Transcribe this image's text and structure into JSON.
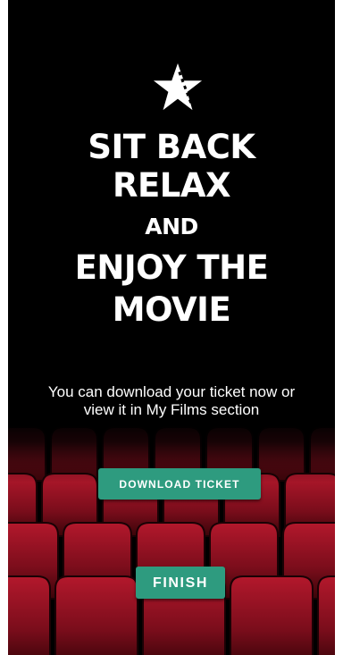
{
  "theme": {
    "background": "#000000",
    "seat_color": "#8a1020",
    "button_color": "#2e9b7f",
    "text_color": "#ffffff"
  },
  "logo": {
    "icon": "film-star-icon"
  },
  "headline": {
    "line1": "SIT BACK",
    "line2": "RELAX",
    "line3": "AND",
    "line4": "ENJOY THE",
    "line5": "MOVIE"
  },
  "info_text": "You can download your ticket now or view it in My Films section",
  "actions": {
    "download_label": "DOWNLOAD TICKET",
    "finish_label": "FINISH"
  }
}
